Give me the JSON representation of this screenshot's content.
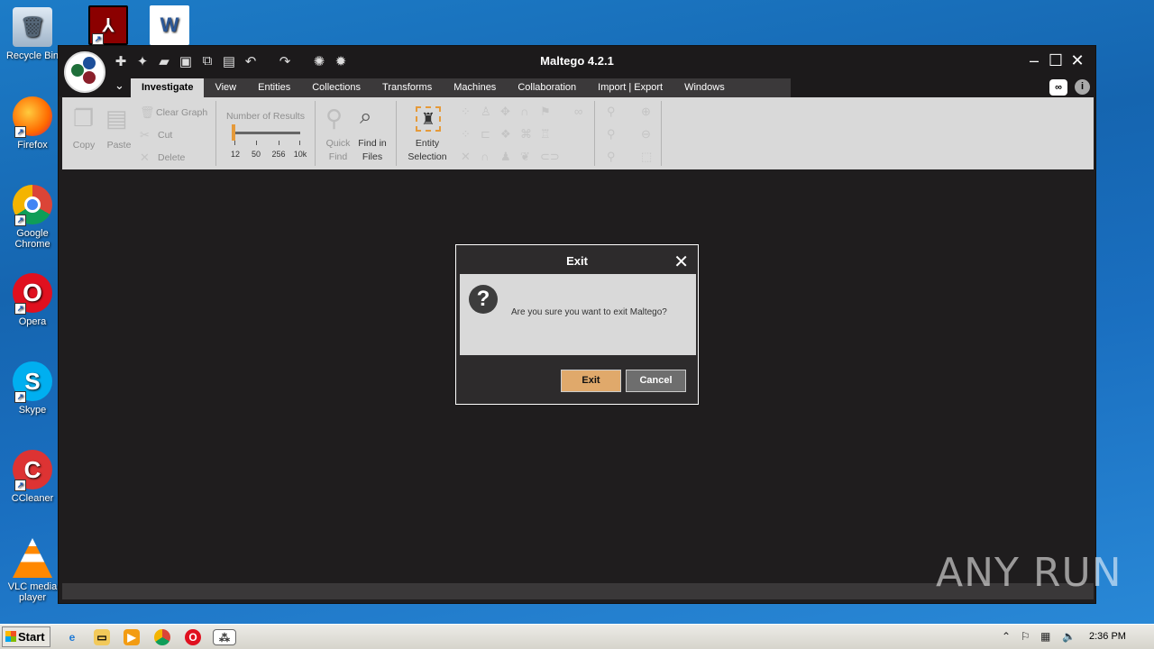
{
  "desktop": {
    "icons": [
      "Recycle Bin",
      "Firefox",
      "Google Chrome",
      "Opera",
      "Skype",
      "CCleaner",
      "VLC media player"
    ]
  },
  "app": {
    "title": "Maltego 4.2.1",
    "tabs": [
      "Investigate",
      "View",
      "Entities",
      "Collections",
      "Transforms",
      "Machines",
      "Collaboration",
      "Import | Export",
      "Windows"
    ],
    "active_tab": "Investigate",
    "ribbon": {
      "copy": "Copy",
      "paste": "Paste",
      "clear_graph": "Clear Graph",
      "cut": "Cut",
      "delete": "Delete",
      "number_of_results": "Number of Results",
      "slider_ticks": [
        "12",
        "50",
        "256",
        "10k"
      ],
      "slider_value": "12",
      "quick_find": "Quick Find",
      "find_in_files": "Find in Files",
      "entity_selection": "Entity Selection"
    }
  },
  "dialog": {
    "title": "Exit",
    "message": "Are you sure you want to exit Maltego?",
    "exit_label": "Exit",
    "cancel_label": "Cancel"
  },
  "watermark": "ANY RUN",
  "taskbar": {
    "start_label": "Start",
    "clock": "2:36 PM"
  },
  "colors": {
    "accent_exit": "#e0a96b",
    "app_bg": "#1f1d1e",
    "ribbon_bg": "#d9d9d9"
  }
}
